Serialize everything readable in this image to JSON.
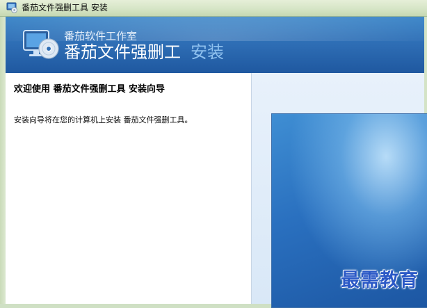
{
  "window": {
    "title": "番茄文件强删工具 安装",
    "icon": "installer-icon"
  },
  "banner": {
    "studio": "番茄软件工作室",
    "product": "番茄文件强删工",
    "install": "安装",
    "icon": "installer-cd-monitor-icon",
    "colors": {
      "top": "#3f88c9",
      "bottom": "#1f58a0"
    }
  },
  "content": {
    "heading": "欢迎使用 番茄文件强删工具 安装向导",
    "description": "安装向导将在您的计算机上安装 番茄文件强删工具。"
  },
  "watermark": {
    "text": "最需教育"
  }
}
